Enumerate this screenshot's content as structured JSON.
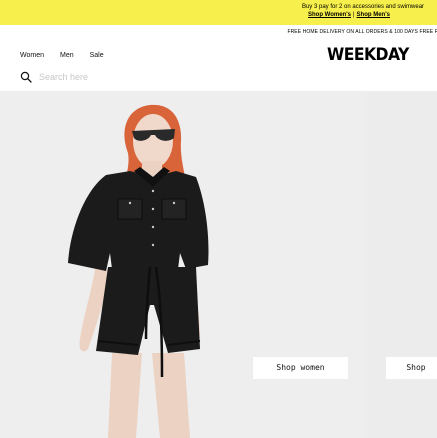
{
  "promo": {
    "message": "Buy 3 pay for 2 on accessories and swimwear",
    "link_women": "Shop Women's",
    "separator": "|",
    "link_men": "Shop Men's"
  },
  "delivery_text": "FREE HOME DELIVERY ON ALL ORDERS & 100 DAYS FREE RET",
  "nav": {
    "women": "Women",
    "men": "Men",
    "sale": "Sale"
  },
  "search": {
    "placeholder": "Search here"
  },
  "brand": {
    "logo_text": "WEEKDAY"
  },
  "hero": {
    "shop_women_label": "Shop women",
    "shop_men_label": "Shop"
  },
  "colors": {
    "promo_background": "#f7ef4b",
    "hero_background": "#eeeeee",
    "outfit": "#1a1a1a",
    "hair": "#d9643a"
  }
}
